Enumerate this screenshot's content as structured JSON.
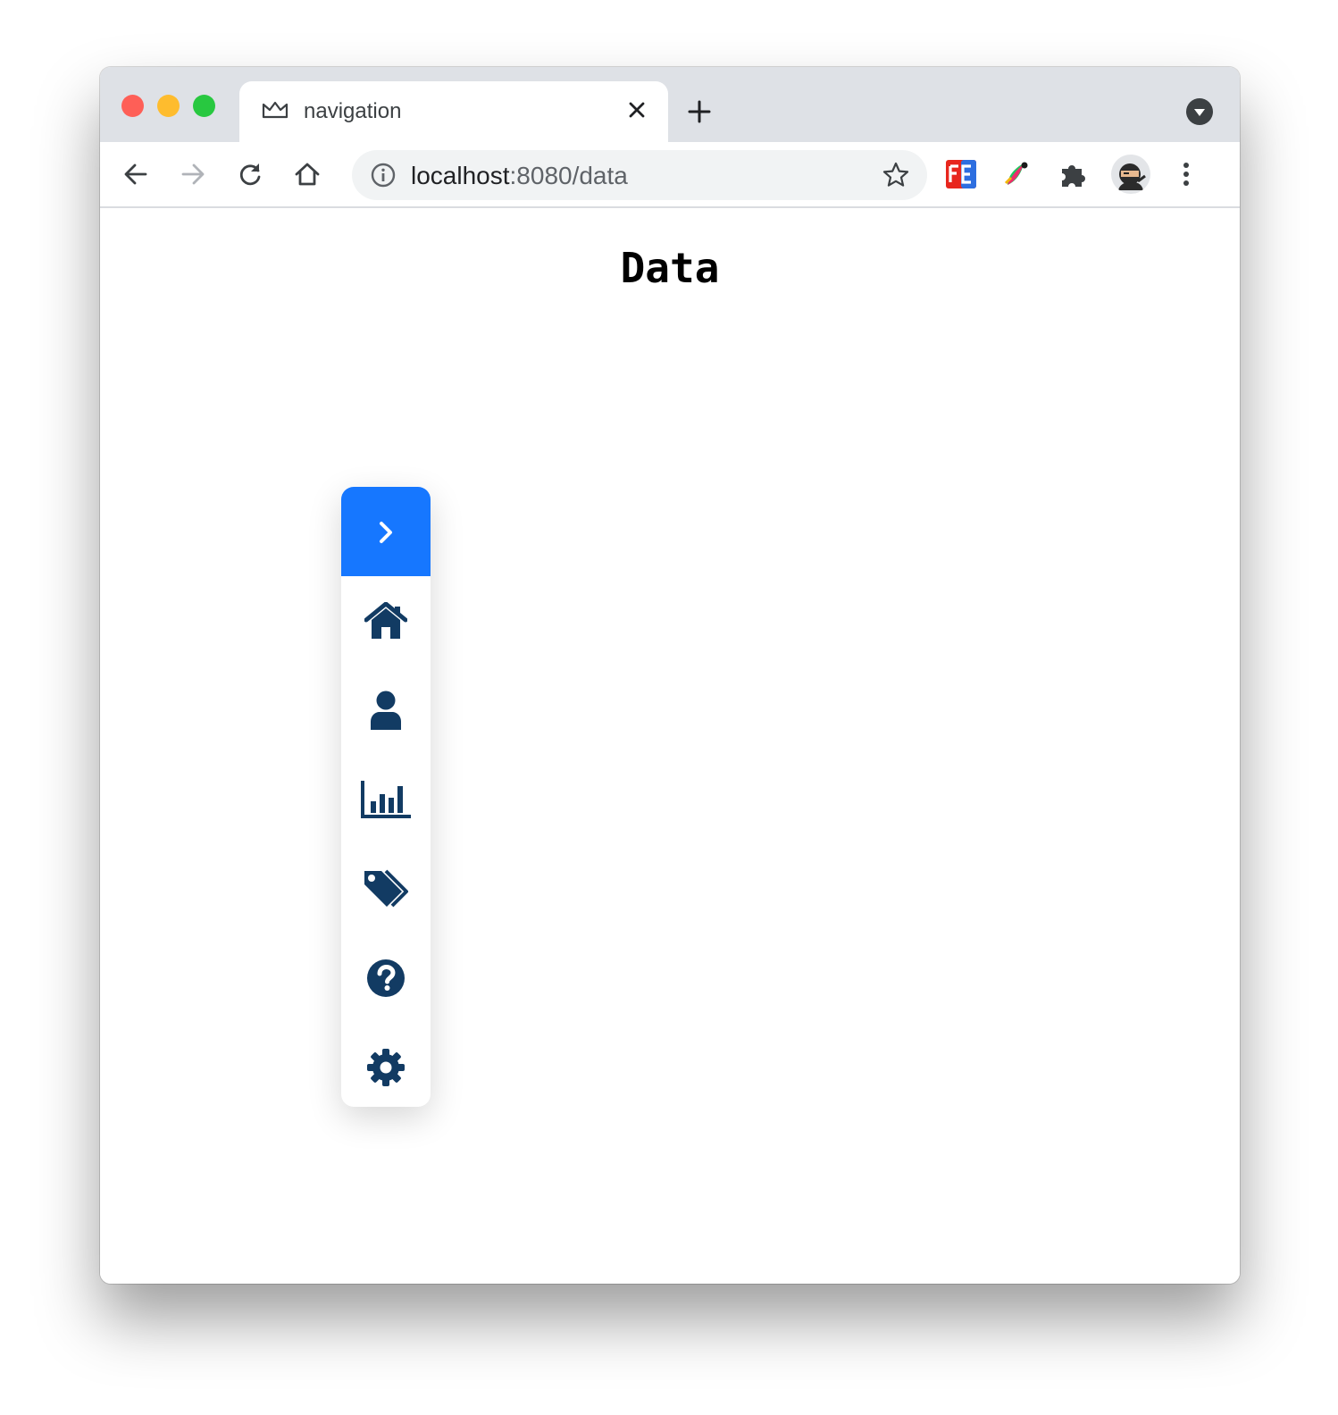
{
  "browser": {
    "tab": {
      "title": "navigation"
    },
    "address": {
      "host": "localhost",
      "path": ":8080/data"
    }
  },
  "page": {
    "title": "Data"
  },
  "sidebar": {
    "toggle_icon": "chevron-right-icon",
    "items": [
      {
        "icon": "home-icon"
      },
      {
        "icon": "user-icon"
      },
      {
        "icon": "chart-bar-icon"
      },
      {
        "icon": "tags-icon"
      },
      {
        "icon": "question-circle-icon"
      },
      {
        "icon": "gear-icon"
      }
    ]
  },
  "colors": {
    "accent": "#1677ff",
    "icon": "#123b63",
    "titlebar": "#dee1e6"
  }
}
